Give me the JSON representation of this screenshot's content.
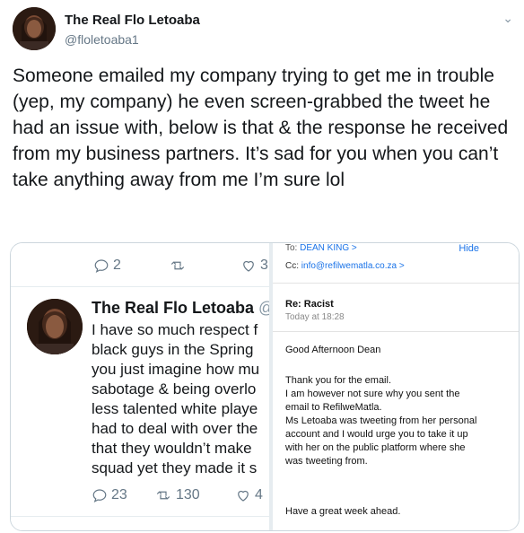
{
  "author": {
    "name": "The Real Flo Letoaba",
    "handle": "@floletoaba1",
    "avatar_icon": "profile-photo"
  },
  "tweet": {
    "text": "Someone emailed my company trying to get me in trouble (yep, my company) he even screen-grabbed the tweet he had an issue with, below is that & the response he received from my business partners. It’s sad for you when you can’t take anything away from me I’m sure lol"
  },
  "left_shot": {
    "top_actions": {
      "replies": "2",
      "likes": "3"
    },
    "name": "The Real Flo Letoaba",
    "handle_fragment": "@",
    "lines": [
      "I have so much respect f",
      "black guys in the Spring",
      "you just imagine how mu",
      "sabotage & being overlo",
      "less talented white playe",
      "had to deal with over the",
      "that they wouldn’t make",
      "squad yet they made it s"
    ],
    "bottom_actions": {
      "replies": "23",
      "retweets": "130",
      "likes": "4"
    }
  },
  "right_shot": {
    "to_prefix": "To:",
    "to_value": "DEAN KING >",
    "hide": "Hide",
    "cc_prefix": "Cc:",
    "cc_value": "info@refilwematla.co.za >",
    "subject": "Re: Racist",
    "time": "Today at 18:28",
    "greeting": "Good Afternoon Dean",
    "body_lines": [
      "Thank you for the email.",
      "I am however not sure why you sent the",
      "email to RefilweMatla.",
      "Ms Letoaba was tweeting from her personal",
      "account and I would urge you to take it up",
      "with her on the public platform where she",
      "was tweeting from."
    ],
    "closing": "Have a great week ahead."
  }
}
